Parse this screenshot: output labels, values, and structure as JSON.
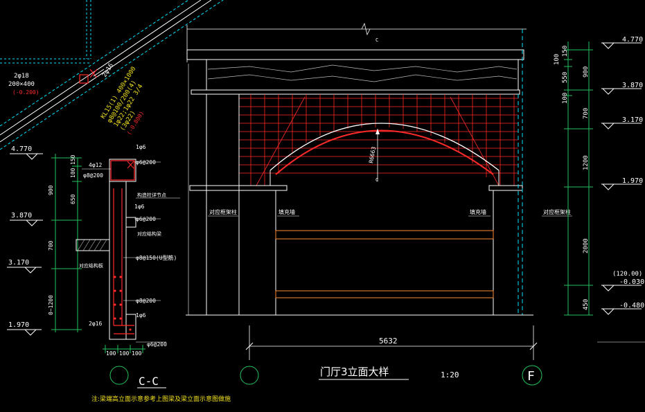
{
  "colors": {
    "background": "#000000",
    "white": "#ffffff",
    "green": "#22c55e",
    "cyan": "#00e5ff",
    "red": "#ff2a2a",
    "yellow": "#f0e020",
    "orange": "#ff8c33",
    "grey": "#bdbdbd"
  },
  "beam_note": {
    "bars_top": "2φ18",
    "size": "200×400",
    "elev": "(-0.200)"
  },
  "kl_note": {
    "stirrup_top": "2φ16",
    "line1": "KL15(1) 400×1000",
    "line2": "φ8@100/200(4)",
    "line3": "1φ22;1φ22 3/4",
    "line4": "(3φ22)",
    "elev": "(-0.800)"
  },
  "section_cc": {
    "levels": [
      "4.770",
      "3.870",
      "3.170",
      "1.970"
    ],
    "dims_vertical": [
      "150",
      "100",
      "650",
      "900",
      "700",
      "0~1200"
    ],
    "callouts": [
      "4φ12",
      "φ8@200",
      "1φ6",
      "φ6@200",
      "1φ6",
      "φ6@200",
      "φ8@150(U型筋)",
      "φ8@200",
      "2φ16",
      "1φ6",
      "φ6@200"
    ],
    "notes": [
      "构造柱详节点",
      "对应结构梁",
      "对应结构板"
    ],
    "dims_bottom": [
      "100",
      "100",
      "100"
    ],
    "title": "C-C",
    "footnote": "注:梁端高立面示意参考上图梁及梁立面示意图做施"
  },
  "elevation": {
    "levels": [
      "4.770",
      "3.870",
      "3.170",
      "1.970",
      "(120.00)",
      "-0.030",
      "-0.480"
    ],
    "dims_right": [
      "150",
      "100",
      "550",
      "900",
      "100",
      "700",
      "1200",
      "2000",
      "450"
    ],
    "radius_label": "R6663",
    "labels": {
      "left_column": "对应框架柱",
      "left_infill": "填充墙",
      "right_infill": "填充墙",
      "right_column": "对应框架柱"
    },
    "total_width": "5632",
    "axis_c_marker": "C",
    "title": "门厅3立面大样",
    "scale": "1:20",
    "axis_right": "F"
  }
}
